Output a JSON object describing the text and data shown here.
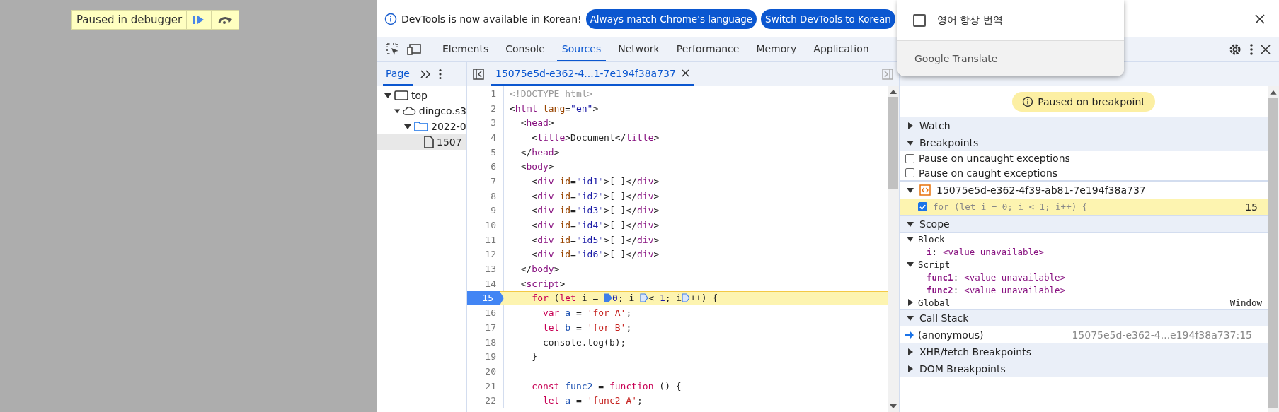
{
  "page": {
    "paused_label": "Paused in debugger"
  },
  "infobar": {
    "message": "DevTools is now available in Korean!",
    "buttons": [
      "Always match Chrome's language",
      "Switch DevTools to Korean"
    ]
  },
  "translate_popup": {
    "option": {
      "label": "영어 항상 번역",
      "checked": false
    },
    "footer": "Google Translate"
  },
  "tabs": [
    {
      "label": "Elements",
      "selected": false
    },
    {
      "label": "Console",
      "selected": false
    },
    {
      "label": "Sources",
      "selected": true
    },
    {
      "label": "Network",
      "selected": false
    },
    {
      "label": "Performance",
      "selected": false
    },
    {
      "label": "Memory",
      "selected": false
    },
    {
      "label": "Application",
      "selected": false
    }
  ],
  "navigator": {
    "tabs": [
      {
        "label": "Page",
        "selected": true
      }
    ],
    "tree": [
      {
        "label": "top",
        "kind": "frame",
        "expanded": true,
        "selected": false,
        "children": [
          {
            "label": "dingco.s3",
            "kind": "domain",
            "expanded": true,
            "selected": false,
            "children": [
              {
                "label": "2022-0",
                "kind": "folder",
                "expanded": true,
                "selected": false,
                "children": [
                  {
                    "label": "1507",
                    "kind": "file",
                    "selected": true
                  }
                ]
              }
            ]
          }
        ]
      }
    ]
  },
  "editor": {
    "tab": "15075e5d-e362-4...1-7e194f38a737",
    "lines": [
      {
        "n": "1",
        "breakpoint": false,
        "current": false,
        "tokens": [
          {
            "t": "<!DOCTYPE html>",
            "kind": "comment"
          }
        ]
      },
      {
        "n": "2",
        "breakpoint": false,
        "current": false,
        "tokens": [
          {
            "t": "<",
            "kind": "plain"
          },
          {
            "t": "html",
            "kind": "tag"
          },
          {
            "t": " lang",
            "kind": "attr"
          },
          {
            "t": "=",
            "kind": "plain"
          },
          {
            "t": "\"en\"",
            "kind": "val"
          },
          {
            "t": ">",
            "kind": "plain"
          }
        ]
      },
      {
        "n": "3",
        "breakpoint": false,
        "current": false,
        "tokens": [
          {
            "t": "  <",
            "kind": "plain"
          },
          {
            "t": "head",
            "kind": "tag"
          },
          {
            "t": ">",
            "kind": "plain"
          }
        ]
      },
      {
        "n": "4",
        "breakpoint": false,
        "current": false,
        "tokens": [
          {
            "t": "    <",
            "kind": "plain"
          },
          {
            "t": "title",
            "kind": "tag"
          },
          {
            "t": ">Document</",
            "kind": "plain"
          },
          {
            "t": "title",
            "kind": "tag"
          },
          {
            "t": ">",
            "kind": "plain"
          }
        ]
      },
      {
        "n": "5",
        "breakpoint": false,
        "current": false,
        "tokens": [
          {
            "t": "  </",
            "kind": "plain"
          },
          {
            "t": "head",
            "kind": "tag"
          },
          {
            "t": ">",
            "kind": "plain"
          }
        ]
      },
      {
        "n": "6",
        "breakpoint": false,
        "current": false,
        "tokens": [
          {
            "t": "  <",
            "kind": "plain"
          },
          {
            "t": "body",
            "kind": "tag"
          },
          {
            "t": ">",
            "kind": "plain"
          }
        ]
      },
      {
        "n": "7",
        "breakpoint": false,
        "current": false,
        "tokens": [
          {
            "t": "    <",
            "kind": "plain"
          },
          {
            "t": "div",
            "kind": "tag"
          },
          {
            "t": " id",
            "kind": "attr"
          },
          {
            "t": "=",
            "kind": "plain"
          },
          {
            "t": "\"id1\"",
            "kind": "val"
          },
          {
            "t": ">[ ]</",
            "kind": "plain"
          },
          {
            "t": "div",
            "kind": "tag"
          },
          {
            "t": ">",
            "kind": "plain"
          }
        ]
      },
      {
        "n": "8",
        "breakpoint": false,
        "current": false,
        "tokens": [
          {
            "t": "    <",
            "kind": "plain"
          },
          {
            "t": "div",
            "kind": "tag"
          },
          {
            "t": " id",
            "kind": "attr"
          },
          {
            "t": "=",
            "kind": "plain"
          },
          {
            "t": "\"id2\"",
            "kind": "val"
          },
          {
            "t": ">[ ]</",
            "kind": "plain"
          },
          {
            "t": "div",
            "kind": "tag"
          },
          {
            "t": ">",
            "kind": "plain"
          }
        ]
      },
      {
        "n": "9",
        "breakpoint": false,
        "current": false,
        "tokens": [
          {
            "t": "    <",
            "kind": "plain"
          },
          {
            "t": "div",
            "kind": "tag"
          },
          {
            "t": " id",
            "kind": "attr"
          },
          {
            "t": "=",
            "kind": "plain"
          },
          {
            "t": "\"id3\"",
            "kind": "val"
          },
          {
            "t": ">[ ]</",
            "kind": "plain"
          },
          {
            "t": "div",
            "kind": "tag"
          },
          {
            "t": ">",
            "kind": "plain"
          }
        ]
      },
      {
        "n": "10",
        "breakpoint": false,
        "current": false,
        "tokens": [
          {
            "t": "    <",
            "kind": "plain"
          },
          {
            "t": "div",
            "kind": "tag"
          },
          {
            "t": " id",
            "kind": "attr"
          },
          {
            "t": "=",
            "kind": "plain"
          },
          {
            "t": "\"id4\"",
            "kind": "val"
          },
          {
            "t": ">[ ]</",
            "kind": "plain"
          },
          {
            "t": "div",
            "kind": "tag"
          },
          {
            "t": ">",
            "kind": "plain"
          }
        ]
      },
      {
        "n": "11",
        "breakpoint": false,
        "current": false,
        "tokens": [
          {
            "t": "    <",
            "kind": "plain"
          },
          {
            "t": "div",
            "kind": "tag"
          },
          {
            "t": " id",
            "kind": "attr"
          },
          {
            "t": "=",
            "kind": "plain"
          },
          {
            "t": "\"id5\"",
            "kind": "val"
          },
          {
            "t": ">[ ]</",
            "kind": "plain"
          },
          {
            "t": "div",
            "kind": "tag"
          },
          {
            "t": ">",
            "kind": "plain"
          }
        ]
      },
      {
        "n": "12",
        "breakpoint": false,
        "current": false,
        "tokens": [
          {
            "t": "    <",
            "kind": "plain"
          },
          {
            "t": "div",
            "kind": "tag"
          },
          {
            "t": " id",
            "kind": "attr"
          },
          {
            "t": "=",
            "kind": "plain"
          },
          {
            "t": "\"id6\"",
            "kind": "val"
          },
          {
            "t": ">[ ]</",
            "kind": "plain"
          },
          {
            "t": "div",
            "kind": "tag"
          },
          {
            "t": ">",
            "kind": "plain"
          }
        ]
      },
      {
        "n": "13",
        "breakpoint": false,
        "current": false,
        "tokens": [
          {
            "t": "  </",
            "kind": "plain"
          },
          {
            "t": "body",
            "kind": "tag"
          },
          {
            "t": ">",
            "kind": "plain"
          }
        ]
      },
      {
        "n": "14",
        "breakpoint": false,
        "current": false,
        "tokens": [
          {
            "t": "  <",
            "kind": "plain"
          },
          {
            "t": "script",
            "kind": "tag"
          },
          {
            "t": ">",
            "kind": "plain"
          }
        ]
      },
      {
        "n": "15",
        "breakpoint": true,
        "current": true,
        "tokens": [
          {
            "t": "    for",
            "kind": "kw"
          },
          {
            "t": " (",
            "kind": "plain"
          },
          {
            "t": "let",
            "kind": "kw"
          },
          {
            "t": " i = ",
            "kind": "plain"
          },
          {
            "kind": "marker",
            "active": true
          },
          {
            "t": "0",
            "kind": "num"
          },
          {
            "t": "; i ",
            "kind": "plain"
          },
          {
            "kind": "marker",
            "active": false
          },
          {
            "t": "< ",
            "kind": "plain"
          },
          {
            "t": "1",
            "kind": "num"
          },
          {
            "t": "; i",
            "kind": "plain"
          },
          {
            "kind": "marker",
            "active": false
          },
          {
            "t": "++) {",
            "kind": "plain"
          }
        ]
      },
      {
        "n": "16",
        "breakpoint": false,
        "current": false,
        "tokens": [
          {
            "t": "      var",
            "kind": "kw"
          },
          {
            "t": " a",
            "kind": "def"
          },
          {
            "t": " = ",
            "kind": "plain"
          },
          {
            "t": "'for A'",
            "kind": "str"
          },
          {
            "t": ";",
            "kind": "plain"
          }
        ]
      },
      {
        "n": "17",
        "breakpoint": false,
        "current": false,
        "tokens": [
          {
            "t": "      let",
            "kind": "kw"
          },
          {
            "t": " b",
            "kind": "def"
          },
          {
            "t": " = ",
            "kind": "plain"
          },
          {
            "t": "'for B'",
            "kind": "str"
          },
          {
            "t": ";",
            "kind": "plain"
          }
        ]
      },
      {
        "n": "18",
        "breakpoint": false,
        "current": false,
        "tokens": [
          {
            "t": "      console.log(b);",
            "kind": "plain"
          }
        ]
      },
      {
        "n": "19",
        "breakpoint": false,
        "current": false,
        "tokens": [
          {
            "t": "    }",
            "kind": "plain"
          }
        ]
      },
      {
        "n": "20",
        "breakpoint": false,
        "current": false
      },
      {
        "n": "21",
        "breakpoint": false,
        "current": false,
        "tokens": [
          {
            "t": "    const",
            "kind": "kw"
          },
          {
            "t": " func2",
            "kind": "def"
          },
          {
            "t": " = ",
            "kind": "plain"
          },
          {
            "t": "function",
            "kind": "kw"
          },
          {
            "t": " () {",
            "kind": "plain"
          }
        ]
      },
      {
        "n": "22",
        "breakpoint": false,
        "current": false,
        "tokens": [
          {
            "t": "      let",
            "kind": "kw"
          },
          {
            "t": " a",
            "kind": "def"
          },
          {
            "t": " = ",
            "kind": "plain"
          },
          {
            "t": "'func2 A'",
            "kind": "str"
          },
          {
            "t": ";",
            "kind": "plain"
          }
        ]
      }
    ]
  },
  "debugger": {
    "banner": "Paused on breakpoint",
    "sections": [
      {
        "title": "Watch",
        "expanded": false
      },
      {
        "title": "Breakpoints",
        "expanded": true,
        "options": [
          {
            "label": "Pause on uncaught exceptions",
            "checked": false
          },
          {
            "label": "Pause on caught exceptions",
            "checked": false
          }
        ],
        "files": [
          {
            "name": "15075e5d-e362-4f39-ab81-7e194f38a737",
            "expanded": true,
            "breakpoints": [
              {
                "code": "for (let i = 0; i < 1; i++) {",
                "line": "15",
                "checked": true,
                "current": true
              }
            ]
          }
        ]
      },
      {
        "title": "Scope",
        "expanded": true,
        "scopes": [
          {
            "name": "Block",
            "expanded": true,
            "vars": [
              {
                "name": "i",
                "separator": ":",
                "value": "<value unavailable>"
              }
            ]
          },
          {
            "name": "Script",
            "expanded": true,
            "vars": [
              {
                "name": "func1",
                "separator": ":",
                "value": "<value unavailable>"
              },
              {
                "name": "func2",
                "separator": ":",
                "value": "<value unavailable>"
              }
            ]
          },
          {
            "name": "Global",
            "expanded": false,
            "value": "Window"
          }
        ]
      },
      {
        "title": "Call Stack",
        "expanded": true,
        "frames": [
          {
            "name": "(anonymous)",
            "location": "15075e5d-e362-4...e194f38a737:15",
            "current": true
          }
        ]
      },
      {
        "title": "XHR/fetch Breakpoints",
        "expanded": false
      },
      {
        "title": "DOM Breakpoints",
        "expanded": false
      }
    ]
  }
}
